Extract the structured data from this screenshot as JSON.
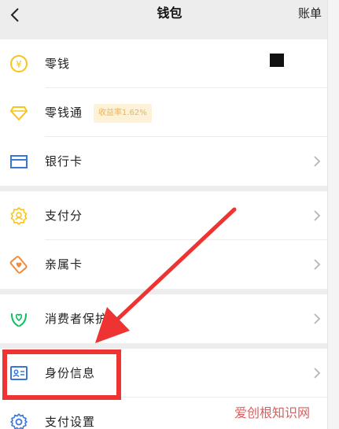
{
  "header": {
    "title": "钱包",
    "bills_label": "账单"
  },
  "group1": [
    {
      "label": "零钱",
      "icon": "coin-yen-icon"
    },
    {
      "label": "零钱通",
      "icon": "diamond-icon",
      "badge": "收益率1.62%"
    },
    {
      "label": "银行卡",
      "icon": "bank-card-icon"
    }
  ],
  "group2": [
    {
      "label": "支付分",
      "icon": "pay-score-icon"
    },
    {
      "label": "亲属卡",
      "icon": "family-card-icon"
    }
  ],
  "group3": [
    {
      "label": "消费者保护",
      "icon": "consumer-protection-icon"
    }
  ],
  "group4": [
    {
      "label": "身份信息",
      "icon": "id-card-icon"
    },
    {
      "label": "支付设置",
      "icon": "gear-icon"
    }
  ],
  "watermark": "爱创根知识网",
  "colors": {
    "accent_green": "#07c160",
    "yellow": "#f5c518",
    "blue": "#3a76d8",
    "orange": "#f08a3c",
    "red": "#ee3333"
  }
}
